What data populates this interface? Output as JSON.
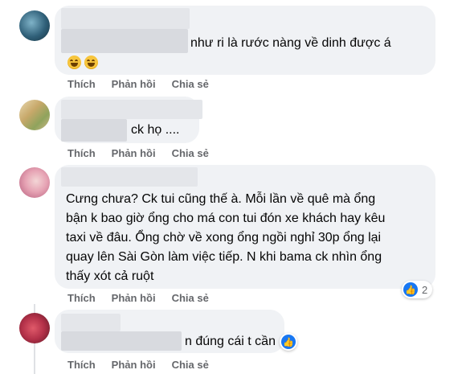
{
  "comments": [
    {
      "text": "như ri là rước nàng về dinh được á",
      "emoji": [
        "laughing-emoji",
        "laughing-emoji"
      ]
    },
    {
      "text": "ck họ ...."
    },
    {
      "lines": [
        "Cưng chưa? Ck tui cũng thế à. Mỗi lần về quê mà ổng",
        "bận k bao giờ ổng cho má con tui đón xe khách hay kêu",
        "taxi về đâu. Ổng chờ về xong ổng ngồi nghỉ 30p ổng lại",
        "quay lên Sài Gòn làm việc tiếp. N khi bama ck nhìn ổng",
        "thấy xót cả ruột"
      ],
      "reaction": {
        "icon": "like-icon",
        "count": "2"
      }
    },
    {
      "text": "n đúng cái t cần",
      "reaction": {
        "icon": "like-icon"
      }
    }
  ],
  "actions": {
    "like": "Thích",
    "reply": "Phản hồi",
    "share": "Chia sẻ"
  },
  "colors": {
    "bubble": "#f0f2f5",
    "action_text": "#65676b",
    "like_blue": "#1877f2"
  }
}
